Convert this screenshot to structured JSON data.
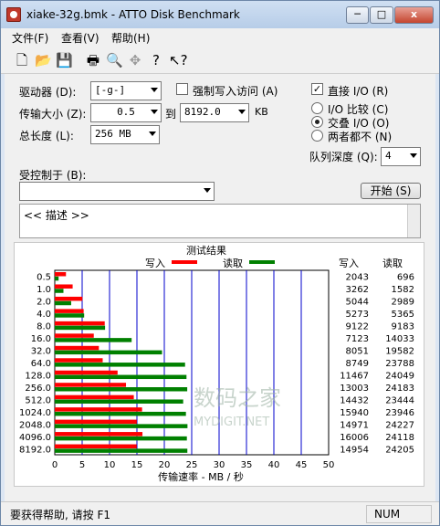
{
  "window": {
    "title": "xiake-32g.bmk - ATTO Disk Benchmark",
    "min_label": "─",
    "max_label": "□",
    "close_label": "x"
  },
  "menu": [
    "文件(F)",
    "查看(V)",
    "帮助(H)"
  ],
  "toolbar": {
    "icons": [
      "new-icon",
      "open-icon",
      "save-icon",
      "print-icon",
      "print-preview-icon",
      "move-icon",
      "help-icon",
      "context-help-icon"
    ]
  },
  "form": {
    "drive_label": "驱动器 (D):",
    "drive_value": "[-g-]",
    "force_write_label": "强制写入访问 (A)",
    "transfer_label": "传输大小 (Z):",
    "transfer_from": "0.5",
    "to_label": "到",
    "transfer_to": "8192.0",
    "kb_label": "KB",
    "total_label": "总长度 (L):",
    "total_value": "256 MB",
    "direct_io_label": "直接 I/O (R)",
    "direct_io_checked": true,
    "io_compare_label": "I/O 比较 (C)",
    "overlap_io_label": "交叠 I/O (O)",
    "neither_label": "两者都不 (N)",
    "queue_label": "队列深度 (Q):",
    "queue_value": "4",
    "controlled_label": "受控制于 (B):",
    "controlled_value": "",
    "start_label": "开始 (S)",
    "description": "<< 描述 >>"
  },
  "results": {
    "title": "测试结果",
    "write_legend": "写入",
    "read_legend": "读取",
    "write_header": "写入",
    "read_header": "读取",
    "xlabel": "传输速率 - MB / 秒",
    "watermark": "数码之家",
    "watermark_url": "MYDIGIT.NET",
    "colors": {
      "write": "#ff0000",
      "read": "#008000",
      "grid": "#0000cc"
    }
  },
  "chart_data": {
    "type": "bar",
    "categories": [
      "0.5",
      "1.0",
      "2.0",
      "4.0",
      "8.0",
      "16.0",
      "32.0",
      "64.0",
      "128.0",
      "256.0",
      "512.0",
      "1024.0",
      "2048.0",
      "4096.0",
      "8192.0"
    ],
    "series": [
      {
        "name": "写入",
        "values": [
          2043,
          3262,
          5044,
          5273,
          9122,
          7123,
          8051,
          8749,
          11467,
          13003,
          14432,
          15940,
          14971,
          16006,
          14954
        ]
      },
      {
        "name": "读取",
        "values": [
          696,
          1582,
          2989,
          5365,
          9183,
          14033,
          19582,
          23788,
          24049,
          24183,
          23444,
          23946,
          24227,
          24118,
          24205
        ]
      }
    ],
    "x_ticks": [
      "0",
      "5",
      "10",
      "15",
      "20",
      "25",
      "30",
      "35",
      "40",
      "45",
      "50"
    ],
    "xlim": [
      0,
      50
    ],
    "xlabel": "传输速率 - MB / 秒",
    "legend": "top"
  },
  "statusbar": {
    "help": "要获得帮助, 请按 F1",
    "num": "NUM"
  }
}
